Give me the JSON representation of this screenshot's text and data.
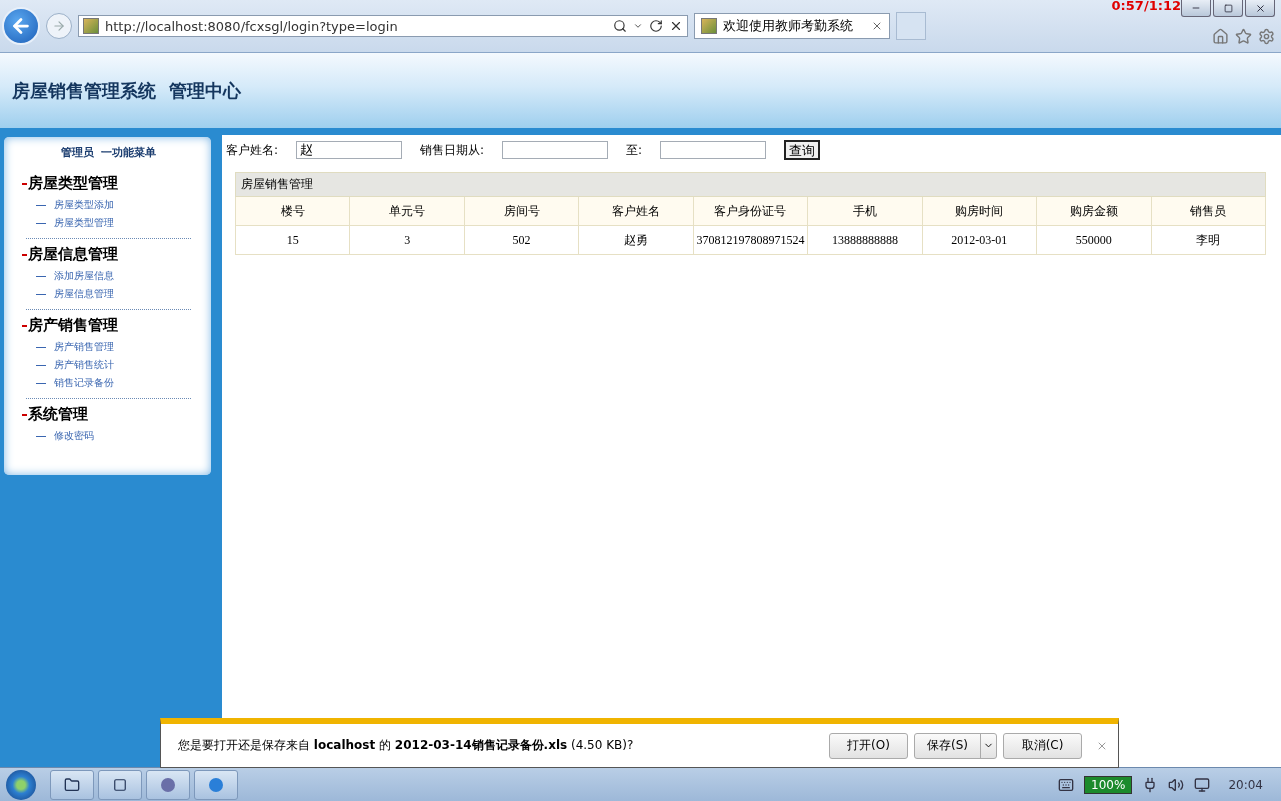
{
  "browser": {
    "url": "http://localhost:8080/fcxsgl/login?type=login",
    "tab_title": "欢迎使用教师考勤系统",
    "recording_time": "0:57/1:12"
  },
  "header": {
    "title": "房屋销售管理系统  管理中心"
  },
  "sidebar": {
    "heading": "管理员  一功能菜单",
    "groups": [
      {
        "title": "房屋类型管理",
        "items": [
          "房屋类型添加",
          "房屋类型管理"
        ]
      },
      {
        "title": "房屋信息管理",
        "items": [
          "添加房屋信息",
          "房屋信息管理"
        ]
      },
      {
        "title": "房产销售管理",
        "items": [
          "房产销售管理",
          "房产销售统计",
          "销售记录备份"
        ]
      },
      {
        "title": "系统管理",
        "items": [
          "修改密码"
        ]
      }
    ]
  },
  "search": {
    "fields": [
      {
        "label": "客户姓名:",
        "value": "赵"
      },
      {
        "label": "销售日期从:"
      },
      {
        "label": "至:"
      }
    ],
    "button": "查询"
  },
  "table": {
    "caption": "房屋销售管理",
    "columns": [
      "楼号",
      "单元号",
      "房间号",
      "客户姓名",
      "客户身份证号",
      "手机",
      "购房时间",
      "购房金额",
      "销售员"
    ],
    "rows": [
      [
        "15",
        "3",
        "502",
        "赵勇",
        "370812197808971524",
        "13888888888",
        "2012-03-01",
        "550000",
        "李明"
      ]
    ]
  },
  "download_bar": {
    "message": "您是要打开还是保存来自 **localhost** 的 **2012-03-14销售记录备份.xls** (4.50 KB)?",
    "buttons": [
      {
        "label": "打开(O)",
        "split": false
      },
      {
        "label": "保存(S)",
        "split": true
      },
      {
        "label": "取消(C)",
        "split": false
      }
    ]
  },
  "taskbar": {
    "battery": "100%",
    "clock": "20:04"
  }
}
